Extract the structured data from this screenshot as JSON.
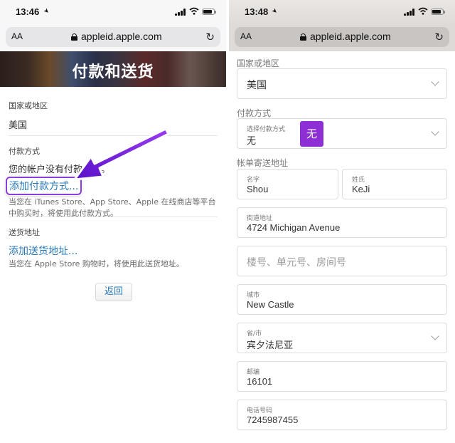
{
  "left": {
    "status": {
      "time": "13:46"
    },
    "browser": {
      "text_size_button": "AA",
      "url": "appleid.apple.com"
    },
    "page_title": "付款和送货",
    "country": {
      "label": "国家或地区",
      "value": "美国"
    },
    "payment": {
      "label": "付款方式",
      "message": "您的帐户没有付款方式。",
      "add_link": "添加付款方式...",
      "note": "当您在 iTunes Store、App Store、Apple 在线商店等平台中购买时，将使用此付款方式。"
    },
    "shipping": {
      "label": "送货地址",
      "add_link": "添加送货地址...",
      "note": "当您在 Apple Store 购物时，将使用此送货地址。"
    },
    "back_button": "返回",
    "annotation_arrow_color": "#7a1fd6"
  },
  "right": {
    "status": {
      "time": "13:48"
    },
    "browser": {
      "text_size_button": "AA",
      "url": "appleid.apple.com"
    },
    "country": {
      "section_label": "国家或地区",
      "value": "美国"
    },
    "payment": {
      "section_label": "付款方式",
      "field_label": "选择付款方式",
      "value": "无",
      "highlight_badge": "无",
      "highlight_color": "#8e2fd6"
    },
    "billing": {
      "section_label": "帐单寄送地址",
      "first_name": {
        "label": "名字",
        "value": "Shou"
      },
      "last_name": {
        "label": "姓氏",
        "value": "KeJi"
      },
      "street": {
        "label": "街道地址",
        "value": "4724 Michigan Avenue"
      },
      "apt": {
        "placeholder": "楼号、单元号、房间号"
      },
      "city": {
        "label": "城市",
        "value": "New Castle"
      },
      "state": {
        "label": "省/市",
        "value": "宾夕法尼亚"
      },
      "zip": {
        "label": "邮编",
        "value": "16101"
      },
      "phone": {
        "label": "电话号码",
        "value": "7245987455"
      }
    }
  }
}
